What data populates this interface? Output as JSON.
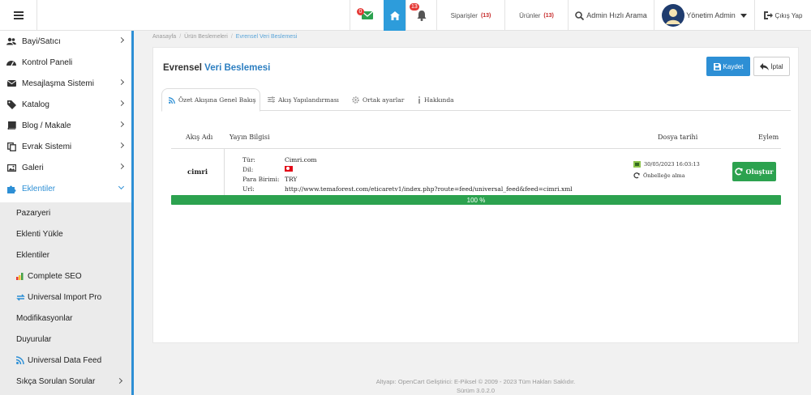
{
  "header": {
    "mail_badge": "0",
    "bell_badge": "13",
    "orders_label": "Siparişler",
    "orders_count": "(13)",
    "products_label": "Ürünler",
    "products_count": "(13)",
    "search_label": "Admin Hızlı Arama",
    "admin_label": "Yönetim Admin",
    "logout_label": "Çıkış Yap"
  },
  "sidebar": {
    "items": [
      {
        "label": "Bayi/Satıcı",
        "icon": "users-icon"
      },
      {
        "label": "Kontrol Paneli",
        "icon": "dashboard-icon"
      },
      {
        "label": "Mesajlaşma Sistemi",
        "icon": "envelope-icon"
      },
      {
        "label": "Katalog",
        "icon": "tag-icon"
      },
      {
        "label": "Blog / Makale",
        "icon": "book-icon"
      },
      {
        "label": "Evrak Sistemi",
        "icon": "copy-icon"
      },
      {
        "label": "Galeri",
        "icon": "image-icon"
      },
      {
        "label": "Eklentiler",
        "icon": "puzzle-icon"
      }
    ],
    "submenu": [
      {
        "label": "Pazaryeri"
      },
      {
        "label": "Eklenti Yükle"
      },
      {
        "label": "Eklentiler"
      },
      {
        "label": "Complete SEO"
      },
      {
        "label": "Universal Import Pro"
      },
      {
        "label": "Modifikasyonlar"
      },
      {
        "label": "Duyurular"
      },
      {
        "label": "Universal Data Feed"
      },
      {
        "label": "Sıkça Sorulan Sorular"
      }
    ]
  },
  "breadcrumb": [
    "Anasayfa",
    "Ürün Beslemeleri",
    "Evrensel Veri Beslemesi"
  ],
  "panel": {
    "title_main": "Evrensel",
    "title_accent": "Veri Beslemesi",
    "save_label": "Kaydet",
    "cancel_label": "İptal"
  },
  "tabs": [
    {
      "label": "Özet Akışına Genel Bakış"
    },
    {
      "label": "Akış Yapılandırması"
    },
    {
      "label": "Ortak ayarlar"
    },
    {
      "label": "Hakkında"
    }
  ],
  "table": {
    "headers": [
      "Akış Adı",
      "Yayın Bilgisi",
      "Dosya tarihi",
      "Eylem"
    ],
    "row": {
      "name": "cimri",
      "info": [
        {
          "key": "Tür:",
          "value": "Cimri.com"
        },
        {
          "key": "Dil:",
          "value": ""
        },
        {
          "key": "Para Birimi:",
          "value": "TRY"
        },
        {
          "key": "Url:",
          "value": "http://www.temaforest.com/eticaretv1/index.php?route=feed/universal_feed&feed=cimri.xml"
        }
      ],
      "date": "30/05/2023 16:03:13",
      "cache_label": "Önbelleğe alma",
      "action_label": "Oluştur"
    }
  },
  "progress": {
    "label": "100 %",
    "value": 100,
    "color": "#2ca24f"
  },
  "footer": {
    "line1": "Altyapı: OpenCart Geliştirici: E-Piksel © 2009 - 2023 Tüm Hakları Saklıdır.",
    "line2": "Sürüm 3.0.2.0"
  }
}
